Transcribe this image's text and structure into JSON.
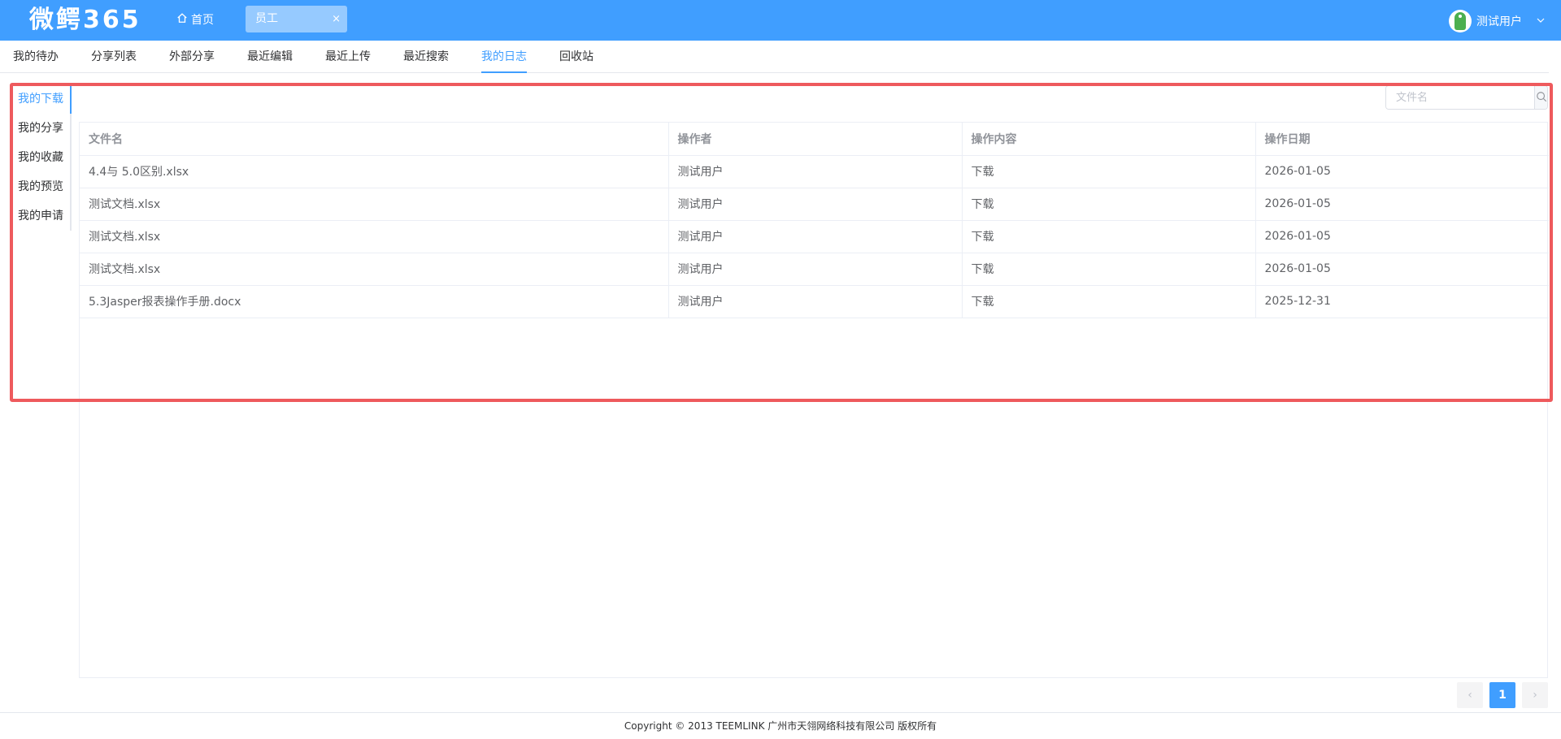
{
  "header": {
    "logo": "微鳄365",
    "home_label": "首页",
    "tab_label": "员工",
    "tab_close": "×",
    "user_name": "测试用户",
    "brand_color": "#409eff"
  },
  "topnav": {
    "items": [
      "我的待办",
      "分享列表",
      "外部分享",
      "最近编辑",
      "最近上传",
      "最近搜索",
      "我的日志",
      "回收站"
    ],
    "active_index": 6
  },
  "sidetabs": {
    "items": [
      "我的下载",
      "我的分享",
      "我的收藏",
      "我的预览",
      "我的申请"
    ],
    "active_index": 0
  },
  "search": {
    "placeholder": "文件名"
  },
  "table": {
    "columns": [
      "文件名",
      "操作者",
      "操作内容",
      "操作日期"
    ],
    "rows": [
      [
        "4.4与 5.0区别.xlsx",
        "测试用户",
        "下载",
        "2026-01-05"
      ],
      [
        "测试文档.xlsx",
        "测试用户",
        "下载",
        "2026-01-05"
      ],
      [
        "测试文档.xlsx",
        "测试用户",
        "下载",
        "2026-01-05"
      ],
      [
        "测试文档.xlsx",
        "测试用户",
        "下载",
        "2026-01-05"
      ],
      [
        "5.3Jasper报表操作手册.docx",
        "测试用户",
        "下载",
        "2025-12-31"
      ]
    ]
  },
  "pagination": {
    "prev": "‹",
    "current": "1",
    "next": "›"
  },
  "footer": {
    "copyright": "Copyright © 2013 TEEMLINK 广州市天翎网络科技有限公司 版权所有"
  }
}
